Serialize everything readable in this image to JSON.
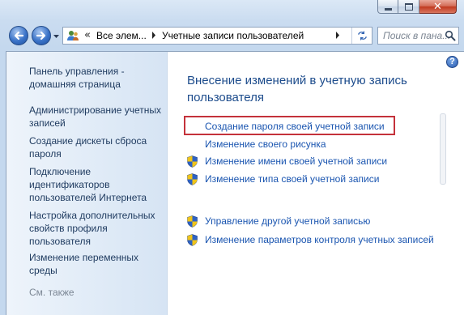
{
  "window": {
    "minimize_icon": "minimize-icon",
    "maximize_icon": "maximize-icon",
    "close_glyph": "✕"
  },
  "nav": {
    "address_segments": [
      "Все элем...",
      "Учетные записи пользователей"
    ],
    "address_prefix": "«",
    "search_placeholder": "Поиск в пана..."
  },
  "sidebar": {
    "home": "Панель управления - домашняя страница",
    "links": [
      "Администрирование учетных записей",
      "Создание дискеты сброса пароля",
      "Подключение идентификаторов пользователей Интернета",
      "Настройка дополнительных свойств профиля пользователя",
      "Изменение переменных среды"
    ],
    "see_also": "См. также"
  },
  "main": {
    "title": "Внесение изменений в учетную запись пользователя",
    "help": "?",
    "tasks": [
      {
        "label": "Создание пароля своей учетной записи",
        "shield": false,
        "highlighted": true
      },
      {
        "label": "Изменение своего рисунка",
        "shield": false
      },
      {
        "label": "Изменение имени своей учетной записи",
        "shield": true
      },
      {
        "label": "Изменение типа своей учетной записи",
        "shield": true
      }
    ],
    "other_tasks": [
      {
        "label": "Управление другой учетной записью",
        "shield": true
      },
      {
        "label": "Изменение параметров контроля учетных записей",
        "shield": true
      }
    ]
  },
  "colors": {
    "link": "#1a55b0",
    "title": "#1d4c8c",
    "highlight_border": "#c4323b"
  }
}
